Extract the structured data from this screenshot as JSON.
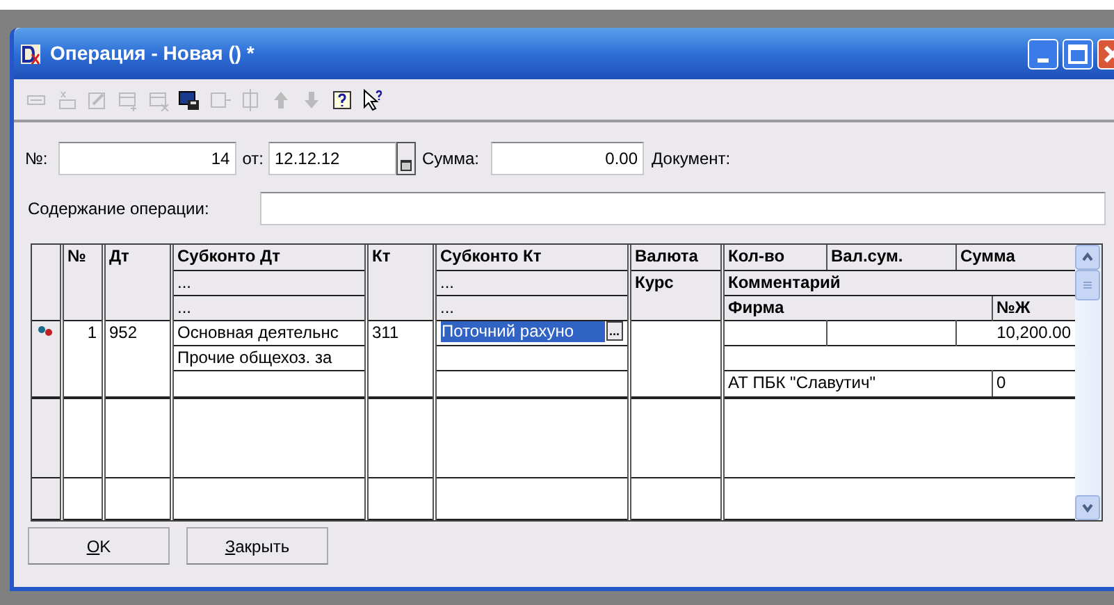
{
  "window": {
    "title": "Операция - Новая () *"
  },
  "toolbar": [
    {
      "disabled": true
    },
    {
      "disabled": true
    },
    {
      "disabled": true
    },
    {
      "disabled": true
    },
    {
      "disabled": true
    },
    {
      "disabled": false
    },
    {
      "disabled": true
    },
    {
      "disabled": true
    },
    {
      "disabled": true
    },
    {
      "disabled": true
    },
    {
      "disabled": false
    },
    {
      "disabled": false
    }
  ],
  "form": {
    "number_label": "№:",
    "number": "14",
    "date_label": "от:",
    "date": "12.12.12",
    "sum_label": "Сумма:",
    "sum": "0.00",
    "document_label": "Документ:",
    "content_label": "Содержание операции:"
  },
  "table": {
    "headers": {
      "number": "№",
      "dt": "Дт",
      "subconto_dt": [
        "Субконто Дт",
        "...",
        "..."
      ],
      "kt": "Кт",
      "subconto_kt": [
        "Субконто Кт",
        "...",
        "..."
      ],
      "currency": "Валюта",
      "rate": "Курс",
      "qty": "Кол-во",
      "val_sum": "Вал.сум.",
      "sum": "Сумма",
      "comment": "Комментарий",
      "firm": "Фирма",
      "journal": "№Ж"
    },
    "rows": [
      {
        "number": "1",
        "dt": "952",
        "subconto_dt": [
          "Основная деятельнс",
          "Прочие общехоз. за"
        ],
        "kt": "311",
        "subconto_kt": [
          {
            "text": "Поточний рахуно",
            "selected": true,
            "button": "..."
          }
        ],
        "sum": "10,200.00",
        "firm": "АТ ПБК \"Славутич\"",
        "journal": "0"
      }
    ]
  },
  "buttons": [
    {
      "label": "OK"
    },
    {
      "label": "Закрыть"
    }
  ]
}
